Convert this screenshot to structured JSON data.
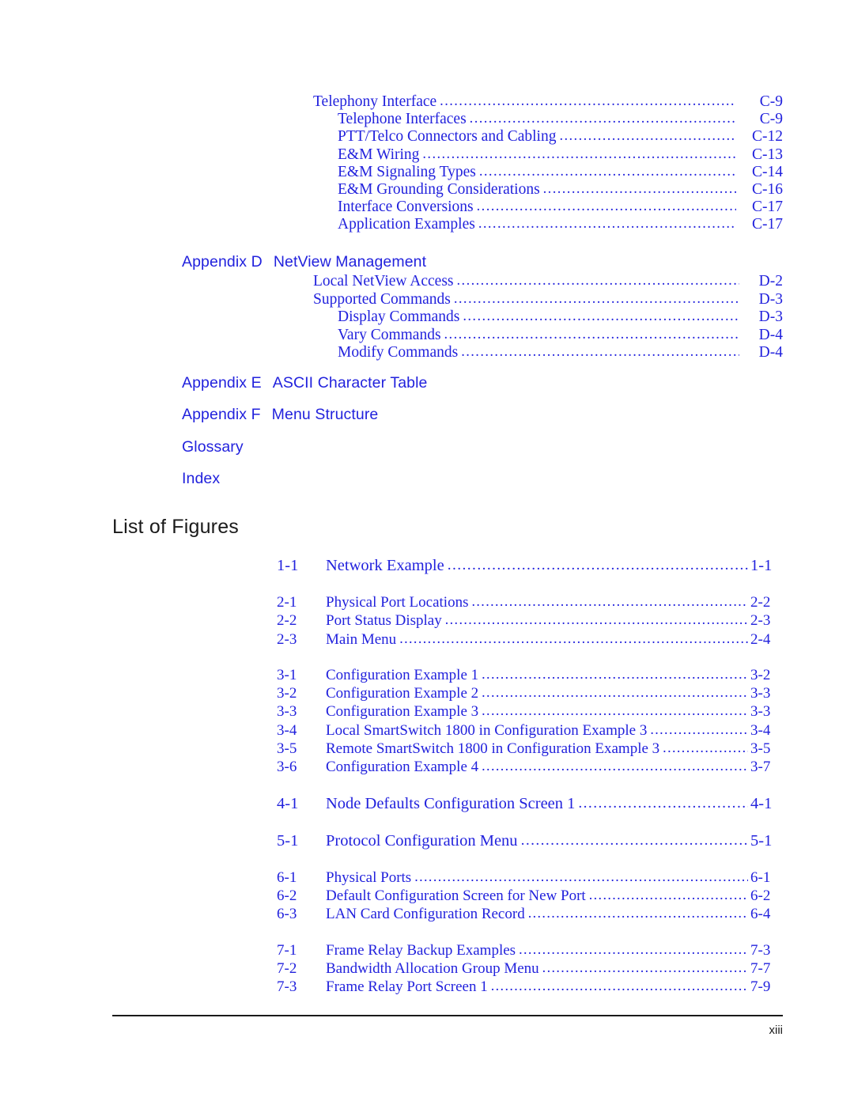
{
  "page": {
    "footer_page_number": "xiii",
    "text_color": "#2222dd",
    "heading_color": "#1a1a1a"
  },
  "toc_continuation": {
    "entries": [
      {
        "level": 1,
        "title": "Telephony Interface",
        "page": "C-9"
      },
      {
        "level": 2,
        "title": "Telephone Interfaces",
        "page": "C-9"
      },
      {
        "level": 2,
        "title": "PTT/Telco Connectors and Cabling",
        "page": "C-12"
      },
      {
        "level": 2,
        "title": "E&M Wiring",
        "page": "C-13"
      },
      {
        "level": 2,
        "title": "E&M Signaling Types",
        "page": "C-14"
      },
      {
        "level": 2,
        "title": "E&M Grounding Considerations",
        "page": "C-16"
      },
      {
        "level": 2,
        "title": "Interface Conversions",
        "page": "C-17"
      },
      {
        "level": 2,
        "title": "Application Examples",
        "page": "C-17"
      }
    ]
  },
  "appendix_d": {
    "label": "Appendix D",
    "title": "NetView Management",
    "entries": [
      {
        "level": 1,
        "title": "Local NetView Access",
        "page": "D-2"
      },
      {
        "level": 1,
        "title": "Supported Commands",
        "page": "D-3"
      },
      {
        "level": 2,
        "title": "Display Commands",
        "page": "D-3"
      },
      {
        "level": 2,
        "title": "Vary Commands",
        "page": "D-4"
      },
      {
        "level": 2,
        "title": "Modify Commands",
        "page": "D-4"
      }
    ]
  },
  "appendix_e": {
    "label": "Appendix E",
    "title": "ASCII Character Table"
  },
  "appendix_f": {
    "label": "Appendix F",
    "title": "Menu Structure"
  },
  "glossary": {
    "label": "Glossary",
    "title": ""
  },
  "index": {
    "label": "Index",
    "title": ""
  },
  "list_of_figures": {
    "heading": "List of Figures",
    "groups": [
      {
        "chapter": "1",
        "size": "big",
        "rows": [
          {
            "number": "1-1",
            "title": "Network Example",
            "page": "1-1"
          }
        ]
      },
      {
        "chapter": "2",
        "size": "normal",
        "rows": [
          {
            "number": "2-1",
            "title": "Physical Port Locations",
            "page": "2-2"
          },
          {
            "number": "2-2",
            "title": "Port Status Display",
            "page": "2-3"
          },
          {
            "number": "2-3",
            "title": "Main Menu",
            "page": "2-4"
          }
        ]
      },
      {
        "chapter": "3",
        "size": "normal",
        "rows": [
          {
            "number": "3-1",
            "title": "Configuration Example 1",
            "page": "3-2"
          },
          {
            "number": "3-2",
            "title": "Configuration Example 2",
            "page": "3-3"
          },
          {
            "number": "3-3",
            "title": "Configuration Example 3",
            "page": "3-3"
          },
          {
            "number": "3-4",
            "title": "Local SmartSwitch 1800 in Configuration Example 3",
            "page": "3-4"
          },
          {
            "number": "3-5",
            "title": "Remote SmartSwitch 1800 in Configuration Example 3",
            "page": "3-5"
          },
          {
            "number": "3-6",
            "title": "Configuration Example 4",
            "page": "3-7"
          }
        ]
      },
      {
        "chapter": "4",
        "size": "big",
        "rows": [
          {
            "number": "4-1",
            "title": "Node Defaults Configuration Screen 1",
            "page": "4-1"
          }
        ]
      },
      {
        "chapter": "5",
        "size": "big",
        "rows": [
          {
            "number": "5-1",
            "title": "Protocol Configuration Menu",
            "page": "5-1"
          }
        ]
      },
      {
        "chapter": "6",
        "size": "normal",
        "rows": [
          {
            "number": "6-1",
            "title": "Physical Ports",
            "page": "6-1"
          },
          {
            "number": "6-2",
            "title": "Default Configuration Screen for New Port",
            "page": "6-2"
          },
          {
            "number": "6-3",
            "title": "LAN Card Configuration Record",
            "page": "6-4"
          }
        ]
      },
      {
        "chapter": "7",
        "size": "normal",
        "rows": [
          {
            "number": "7-1",
            "title": "Frame Relay Backup Examples",
            "page": "7-3"
          },
          {
            "number": "7-2",
            "title": "Bandwidth Allocation Group Menu",
            "page": "7-7"
          },
          {
            "number": "7-3",
            "title": "Frame Relay Port Screen 1",
            "page": "7-9"
          }
        ]
      }
    ]
  }
}
